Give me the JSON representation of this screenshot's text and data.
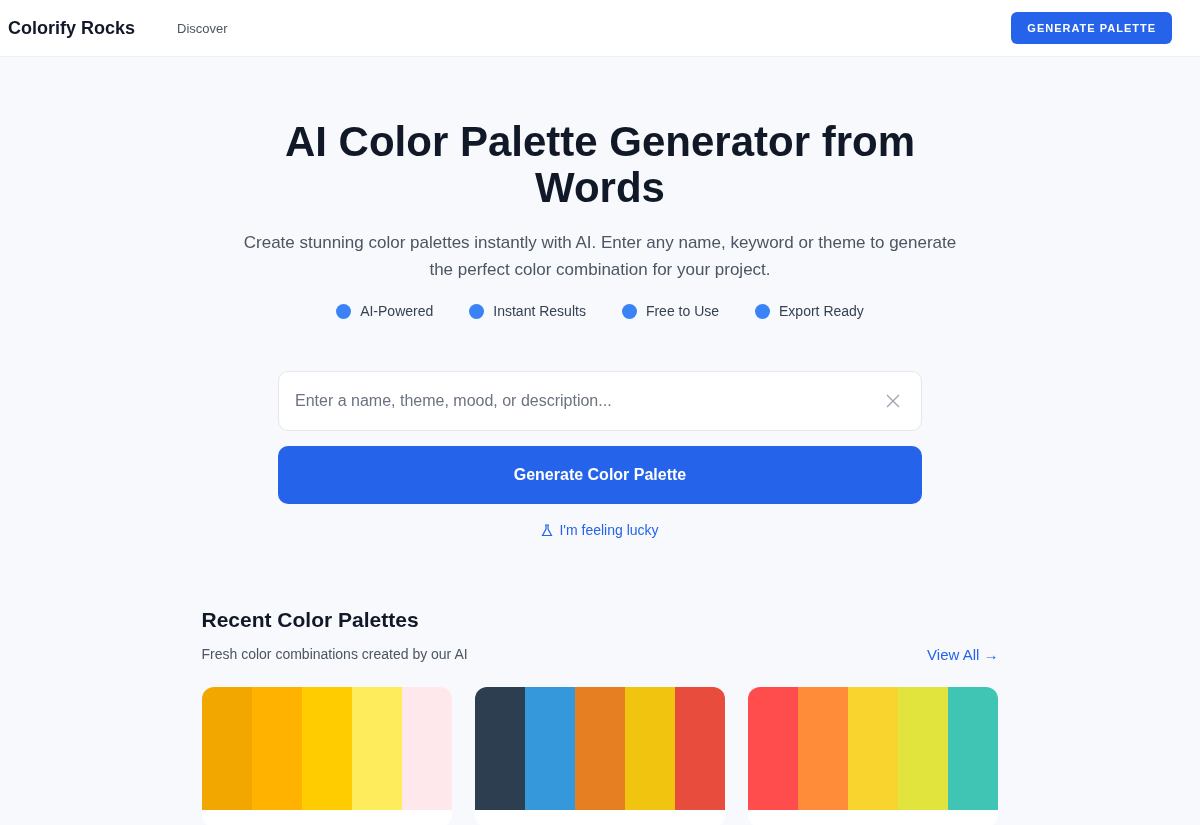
{
  "header": {
    "logo": "Colorify Rocks",
    "nav": [
      "Discover"
    ],
    "cta": "GENERATE PALETTE"
  },
  "hero": {
    "title": "AI Color Palette Generator from Words",
    "subtitle": "Create stunning color palettes instantly with AI. Enter any name, keyword or theme to generate the perfect color combination for your project.",
    "features": [
      "AI-Powered",
      "Instant Results",
      "Free to Use",
      "Export Ready"
    ],
    "search": {
      "placeholder": "Enter a name, theme, mood, or description..."
    },
    "generate_button": "Generate Color Palette",
    "lucky_link": "I'm feeling lucky"
  },
  "recent": {
    "title": "Recent Color Palettes",
    "subtitle": "Fresh color combinations created by our AI",
    "view_all": "View All →",
    "palettes": [
      {
        "swatches": [
          {
            "color": "#f2a700"
          },
          {
            "color": "#ffb300"
          },
          {
            "color": "#ffcc00"
          },
          {
            "color": "#ffec5c"
          },
          {
            "color": "#ffe8ec"
          }
        ]
      },
      {
        "swatches": [
          {
            "color": "#2c3e50"
          },
          {
            "color": "#3498db"
          },
          {
            "color": "#e67e22"
          },
          {
            "color": "#f1c40f"
          },
          {
            "color": "#e74c3c"
          }
        ]
      },
      {
        "swatches": [
          {
            "color": "#ff4d4d"
          },
          {
            "color": "#ff8c38"
          },
          {
            "color": "#f9d42f"
          },
          {
            "color": "#e0e43c"
          },
          {
            "color": "#40c4b4"
          }
        ]
      }
    ]
  }
}
